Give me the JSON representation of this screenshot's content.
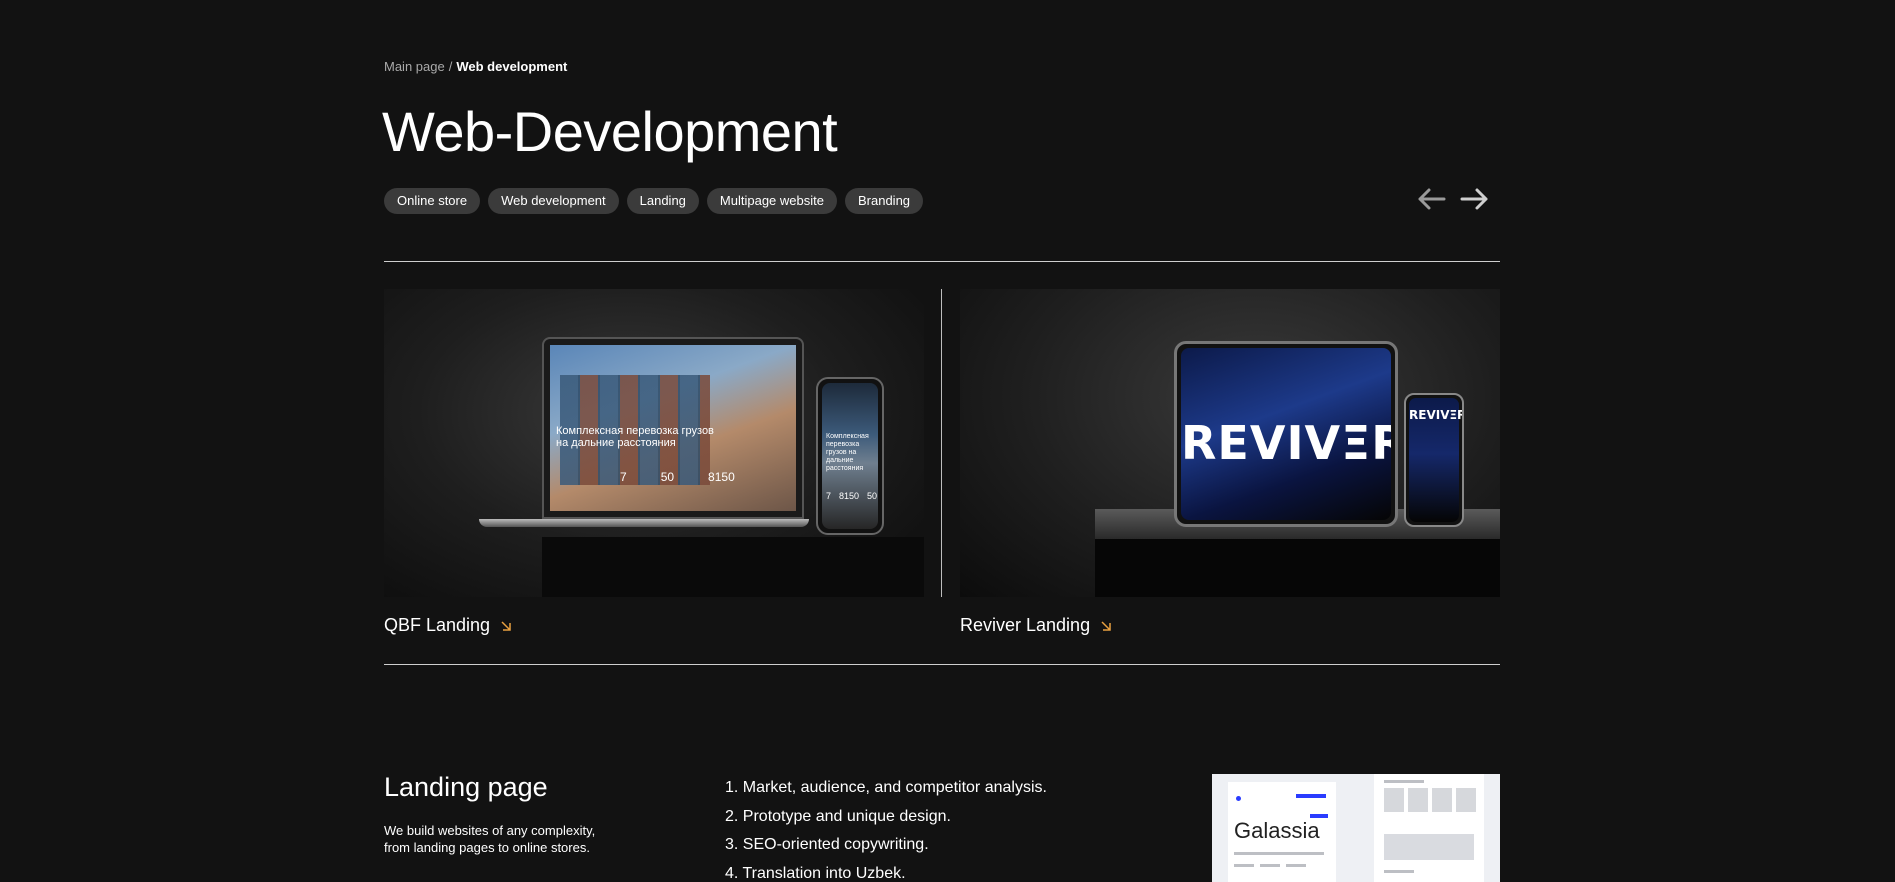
{
  "breadcrumb": {
    "home": "Main page",
    "separator": "/",
    "current": "Web development"
  },
  "page_title": "Web-Development",
  "tags": [
    "Online store",
    "Web development",
    "Landing",
    "Multipage website",
    "Branding"
  ],
  "nav": {
    "prev_icon": "arrow-left-icon",
    "next_icon": "arrow-right-icon"
  },
  "cards": [
    {
      "title": "QBF Landing",
      "mockup": {
        "headline": "Комплексная перевозка грузов на дальние расстояния",
        "stats": [
          "7",
          "50",
          "8150"
        ],
        "phone_headline": "Комплексная перевозка грузов на дальние расстояния",
        "phone_stats": [
          "7",
          "8150",
          "50"
        ]
      }
    },
    {
      "title": "Reviver Landing",
      "mockup": {
        "logo": "REVIVΞR",
        "phone_logo": "REVIVΞR"
      }
    }
  ],
  "section": {
    "title": "Landing page",
    "description": "We build websites of any complexity, from landing pages to online stores.",
    "steps": [
      "1. Market, audience, and competitor analysis.",
      "2. Prototype and unique design.",
      "3. SEO-oriented copywriting.",
      "4. Translation into Uzbek."
    ],
    "preview_brand": "Galassia"
  },
  "colors": {
    "background": "#121212",
    "tag_bg": "#3b3b3b",
    "accent_arrow": "#e8a040",
    "muted_text": "#a9a9a9"
  }
}
